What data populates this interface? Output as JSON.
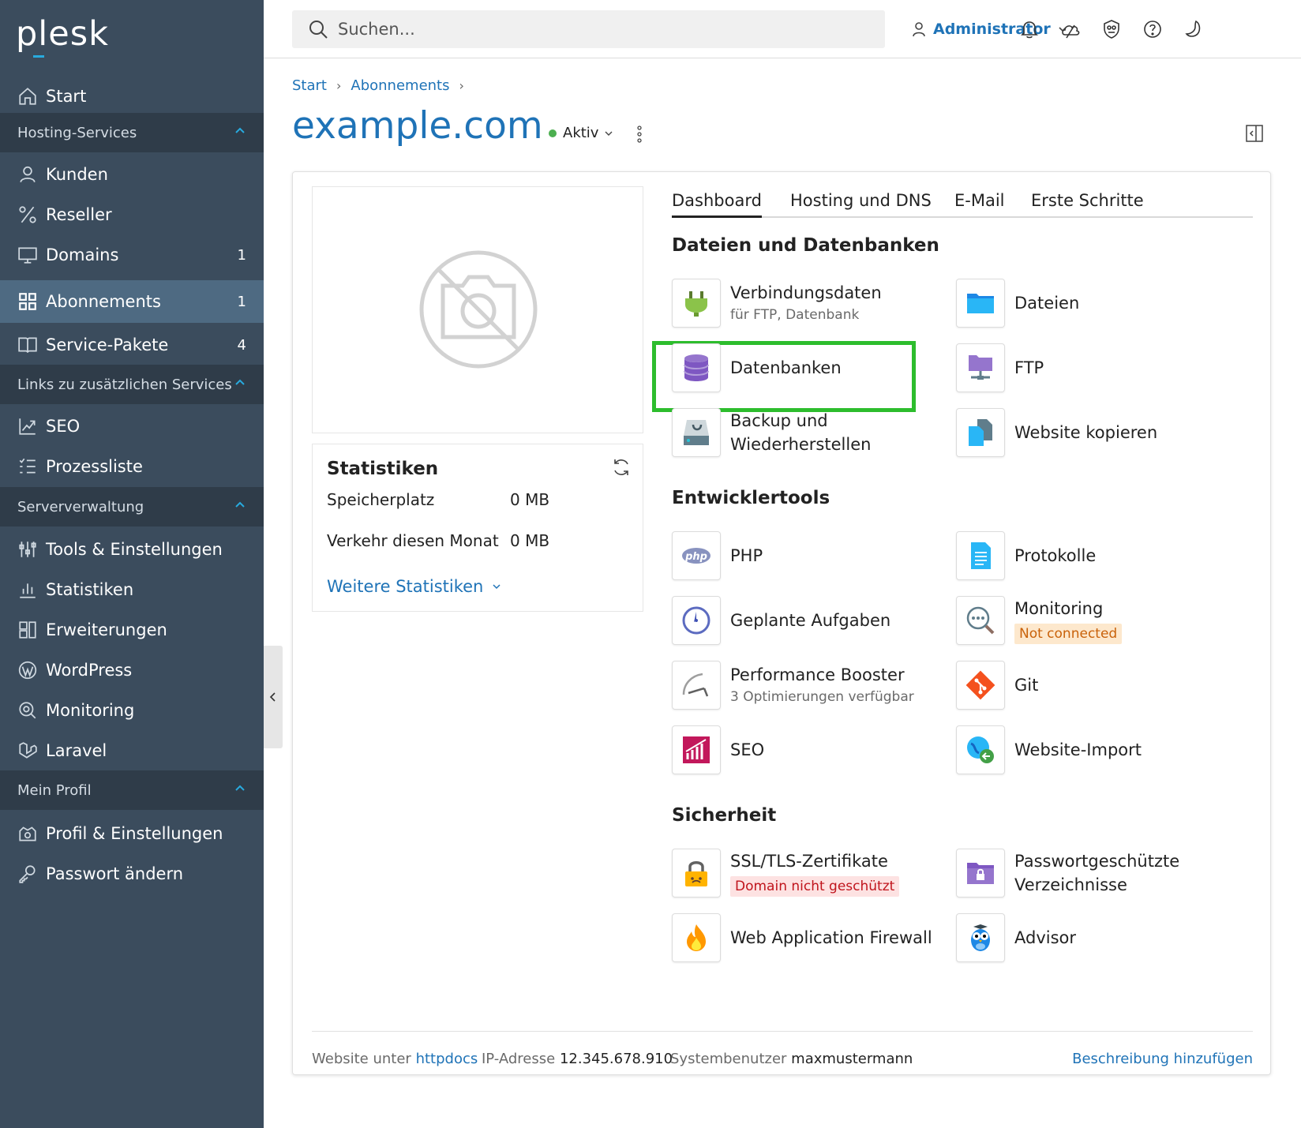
{
  "app": {
    "logo": "plesk"
  },
  "sidebar": {
    "start": "Start",
    "sections": {
      "hosting": "Hosting-Services",
      "links": "Links zu zusätzlichen Services",
      "server": "Serververwaltung",
      "profile": "Mein Profil"
    },
    "items": {
      "kunden": "Kunden",
      "reseller": "Reseller",
      "domains": "Domains",
      "domains_count": "1",
      "abonnements": "Abonnements",
      "abonnements_count": "1",
      "service_pakete": "Service-Pakete",
      "service_pakete_count": "4",
      "seo": "SEO",
      "prozessliste": "Prozessliste",
      "tools": "Tools & Einstellungen",
      "statistiken": "Statistiken",
      "erweiterungen": "Erweiterungen",
      "wordpress": "WordPress",
      "monitoring": "Monitoring",
      "laravel": "Laravel",
      "profil": "Profil & Einstellungen",
      "passwort": "Passwort ändern"
    }
  },
  "topbar": {
    "search_placeholder": "Suchen...",
    "user": "Administrator"
  },
  "breadcrumb": {
    "start": "Start",
    "abonnements": "Abonnements"
  },
  "page": {
    "title": "example.com",
    "status": "Aktiv"
  },
  "stats": {
    "title": "Statistiken",
    "storage_label": "Speicherplatz",
    "storage_value": "0 MB",
    "traffic_label": "Verkehr diesen Monat",
    "traffic_value": "0 MB",
    "more": "Weitere Statistiken"
  },
  "tabs": [
    "Dashboard",
    "Hosting und DNS",
    "E-Mail",
    "Erste Schritte"
  ],
  "sections": {
    "files": "Dateien und Datenbanken",
    "dev": "Entwicklertools",
    "security": "Sicherheit"
  },
  "tools": {
    "verbindungsdaten": "Verbindungsdaten",
    "verbindungsdaten_sub": "für FTP, Datenbank",
    "dateien": "Dateien",
    "datenbanken": "Datenbanken",
    "ftp": "FTP",
    "backup_line1": "Backup und",
    "backup_line2": "Wiederherstellen",
    "website_kopieren": "Website kopieren",
    "php": "PHP",
    "protokolle": "Protokolle",
    "geplante_aufgaben": "Geplante Aufgaben",
    "monitoring": "Monitoring",
    "monitoring_badge": "Not connected",
    "performance_booster": "Performance Booster",
    "performance_sub": "3 Optimierungen verfügbar",
    "git": "Git",
    "seo": "SEO",
    "website_import": "Website-Import",
    "ssl": "SSL/TLS-Zertifikate",
    "ssl_badge": "Domain nicht geschützt",
    "pw_dirs_line1": "Passwortgeschützte",
    "pw_dirs_line2": "Verzeichnisse",
    "waf": "Web Application Firewall",
    "advisor": "Advisor"
  },
  "footer": {
    "website_label": "Website unter",
    "website_link": "httpdocs",
    "ip_label": "IP-Adresse",
    "ip_value": "12.345.678.910",
    "sysuser_label": "Systembenutzer",
    "sysuser_value": "maxmustermann",
    "add_description": "Beschreibung hinzufügen"
  },
  "colors": {
    "sidebar_bg": "#3b4c5d",
    "sidebar_section_bg": "#2f3c49",
    "sidebar_active_bg": "#4e6a82",
    "link_blue": "#1f73b7",
    "highlight_green": "#2dbd2d",
    "status_green": "#4caf50"
  },
  "icons": [
    "home-icon",
    "user-icon",
    "percent-icon",
    "monitor-icon",
    "grid-icon",
    "book-icon",
    "chart-up-icon",
    "list-icon",
    "sliders-icon",
    "bar-chart-icon",
    "extensions-icon",
    "wordpress-icon",
    "search-monitor-icon",
    "laravel-icon",
    "profile-icon",
    "key-icon",
    "search-icon",
    "bell-icon",
    "cloud-icon",
    "shield-icon",
    "help-icon",
    "moon-icon",
    "refresh-icon"
  ]
}
